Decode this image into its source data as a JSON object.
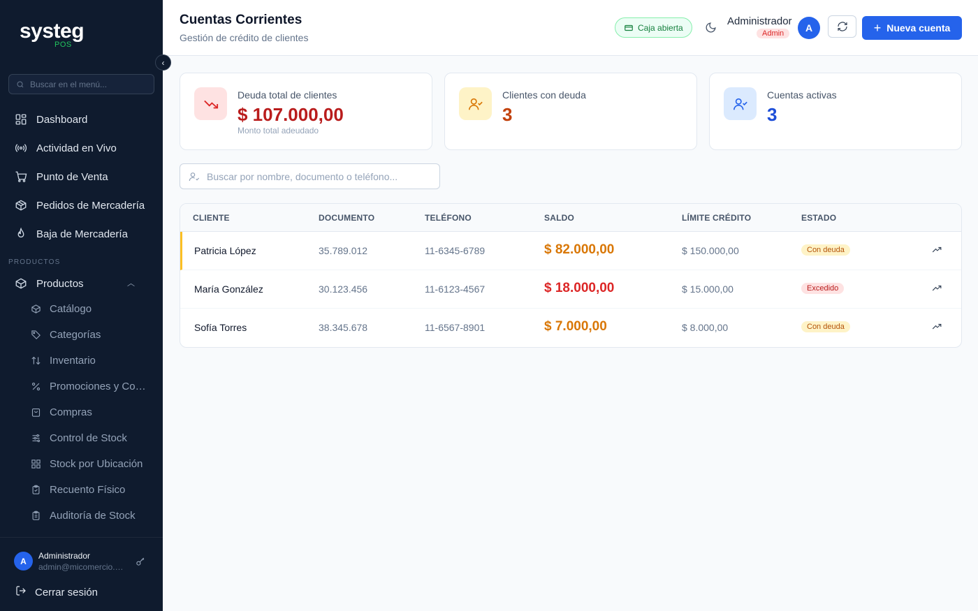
{
  "app": {
    "logo": "systeg",
    "logo_sub": "POS"
  },
  "sidebar": {
    "search_placeholder": "Buscar en el menú...",
    "items": [
      {
        "label": "Dashboard",
        "icon": "dashboard-icon"
      },
      {
        "label": "Actividad en Vivo",
        "icon": "broadcast-icon"
      },
      {
        "label": "Punto de Venta",
        "icon": "cart-icon"
      },
      {
        "label": "Pedidos de Mercadería",
        "icon": "package-icon"
      },
      {
        "label": "Baja de Mercadería",
        "icon": "flame-icon"
      }
    ],
    "section_label": "PRODUCTOS",
    "group": {
      "label": "Productos",
      "icon": "box-icon"
    },
    "sub_items": [
      {
        "label": "Catálogo",
        "icon": "cube-icon"
      },
      {
        "label": "Categorías",
        "icon": "tag-icon"
      },
      {
        "label": "Inventario",
        "icon": "arrows-updown-icon"
      },
      {
        "label": "Promociones y Combos",
        "icon": "percent-icon"
      },
      {
        "label": "Compras",
        "icon": "bag-icon"
      },
      {
        "label": "Control de Stock",
        "icon": "sliders-icon"
      },
      {
        "label": "Stock por Ubicación",
        "icon": "grid-icon"
      },
      {
        "label": "Recuento Físico",
        "icon": "clipboard-check-icon"
      },
      {
        "label": "Auditoría de Stock",
        "icon": "clipboard-list-icon"
      }
    ],
    "user": {
      "initial": "A",
      "name": "Administrador",
      "email": "admin@micomercio.com"
    },
    "logout_label": "Cerrar sesión"
  },
  "header": {
    "title": "Cuentas Corrientes",
    "subtitle": "Gestión de crédito de clientes",
    "caja_label": "Caja abierta",
    "user_name": "Administrador",
    "user_role": "Admin",
    "user_initial": "A",
    "new_button": "Nueva cuenta"
  },
  "stats": [
    {
      "label": "Deuda total de clientes",
      "value": "$ 107.000,00",
      "note": "Monto total adeudado",
      "color": "#b91c1c",
      "icon": "trending-down-icon"
    },
    {
      "label": "Clientes con deuda",
      "value": "3",
      "note": "",
      "color": "#c2410c",
      "icon": "user-check-icon"
    },
    {
      "label": "Cuentas activas",
      "value": "3",
      "note": "",
      "color": "#1d4ed8",
      "icon": "user-check-icon"
    }
  ],
  "search": {
    "placeholder": "Buscar por nombre, documento o teléfono..."
  },
  "table": {
    "headers": [
      "CLIENTE",
      "DOCUMENTO",
      "TELÉFONO",
      "SALDO",
      "LÍMITE CRÉDITO",
      "ESTADO"
    ],
    "rows": [
      {
        "cliente": "Patricia López",
        "documento": "35.789.012",
        "telefono": "11-6345-6789",
        "saldo": "$ 82.000,00",
        "limite": "$ 150.000,00",
        "estado": "Con deuda",
        "saldo_color": "#d97706",
        "estado_type": "warning"
      },
      {
        "cliente": "María González",
        "documento": "30.123.456",
        "telefono": "11-6123-4567",
        "saldo": "$ 18.000,00",
        "limite": "$ 15.000,00",
        "estado": "Excedido",
        "saldo_color": "#dc2626",
        "estado_type": "danger"
      },
      {
        "cliente": "Sofía Torres",
        "documento": "38.345.678",
        "telefono": "11-6567-8901",
        "saldo": "$ 7.000,00",
        "limite": "$ 8.000,00",
        "estado": "Con deuda",
        "saldo_color": "#d97706",
        "estado_type": "warning"
      }
    ]
  },
  "colors": {
    "sidebar_bg": "#0f1b2e",
    "accent": "#2563eb",
    "success": "#15803d",
    "warning": "#d97706",
    "danger": "#dc2626"
  }
}
